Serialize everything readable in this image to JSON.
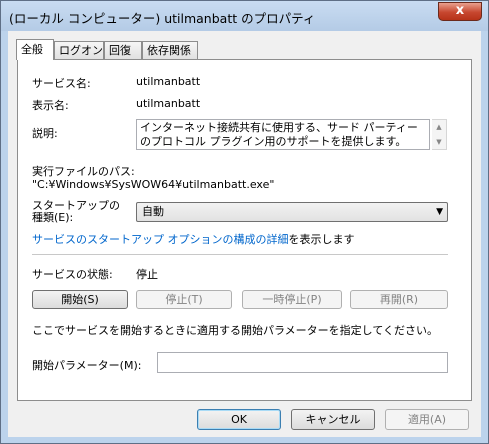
{
  "window": {
    "title": "(ローカル コンピューター) utilmanbatt のプロパティ",
    "close_glyph": "x"
  },
  "tabs": [
    "全般",
    "ログオン",
    "回復",
    "依存関係"
  ],
  "general": {
    "service_name_label": "サービス名:",
    "service_name_value": "utilmanbatt",
    "display_name_label": "表示名:",
    "display_name_value": "utilmanbatt",
    "description_label": "説明:",
    "description_value": "インターネット接続共有に使用する、サード パーティーのプロトコル プラグイン用のサポートを提供します。",
    "exec_path_label": "実行ファイルのパス:",
    "exec_path_value": "\"C:¥Windows¥SysWOW64¥utilmanbatt.exe\"",
    "startup_type_label": "スタートアップの\n種類(E):",
    "startup_type_value": "自動",
    "startup_link": "サービスのスタートアップ オプションの構成の詳細",
    "startup_link_suffix": "を表示します",
    "status_label": "サービスの状態:",
    "status_value": "停止",
    "buttons": {
      "start": "開始(S)",
      "stop": "停止(T)",
      "pause": "一時停止(P)",
      "resume": "再開(R)"
    },
    "params_hint": "ここでサービスを開始するときに適用する開始パラメーターを指定してください。",
    "start_params_label": "開始パラメーター(M):",
    "start_params_value": ""
  },
  "footer": {
    "ok": "OK",
    "cancel": "キャンセル",
    "apply": "適用(A)"
  }
}
